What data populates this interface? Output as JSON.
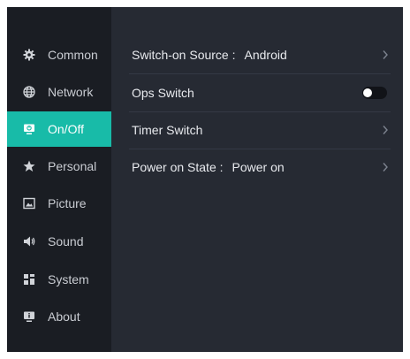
{
  "sidebar": {
    "items": [
      {
        "label": "Common",
        "icon": "gear-icon"
      },
      {
        "label": "Network",
        "icon": "globe-icon"
      },
      {
        "label": "On/Off",
        "icon": "power-monitor-icon",
        "active": true
      },
      {
        "label": "Personal",
        "icon": "star-icon"
      },
      {
        "label": "Picture",
        "icon": "picture-icon"
      },
      {
        "label": "Sound",
        "icon": "speaker-icon"
      },
      {
        "label": "System",
        "icon": "system-icon"
      },
      {
        "label": "About",
        "icon": "info-monitor-icon"
      }
    ],
    "active_color": "#18bba8"
  },
  "main": {
    "rows": [
      {
        "label": "Switch-on Source :",
        "value": "Android",
        "control": "chevron"
      },
      {
        "label": "Ops Switch",
        "value": "",
        "control": "toggle",
        "toggle_on": false
      },
      {
        "label": "Timer Switch",
        "value": "",
        "control": "chevron"
      },
      {
        "label": "Power on State :",
        "value": "Power on",
        "control": "chevron"
      }
    ]
  }
}
